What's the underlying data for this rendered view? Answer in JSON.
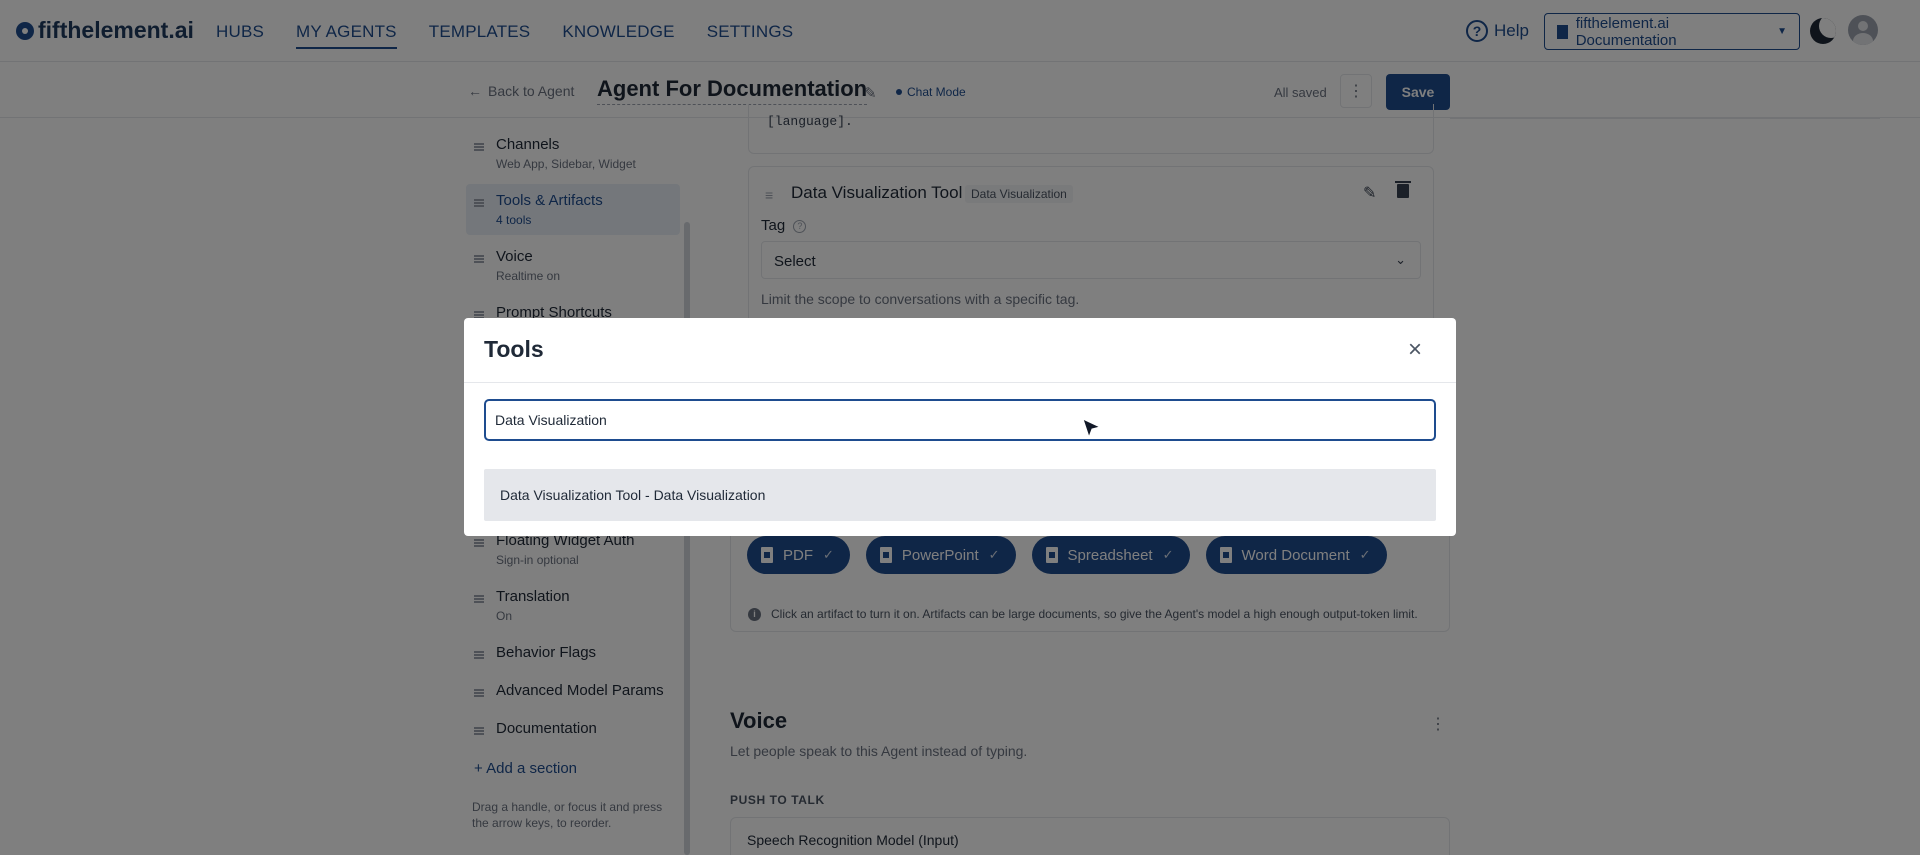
{
  "app": {
    "logo_text": "fifthelement.ai",
    "nav": [
      "HUBS",
      "MY AGENTS",
      "TEMPLATES",
      "KNOWLEDGE",
      "SETTINGS"
    ],
    "help_label": "Help",
    "org_selector": "fifthelement.ai Documentation"
  },
  "header": {
    "back_label": "Back to Agent",
    "agent_title": "Agent For Documentation",
    "mode_label": "Chat Mode",
    "saved_status": "All saved",
    "save_label": "Save"
  },
  "sidebar": {
    "items": [
      {
        "label": "Channels",
        "sub": "Web App, Sidebar, Widget"
      },
      {
        "label": "Tools & Artifacts",
        "sub": "4 tools"
      },
      {
        "label": "Voice",
        "sub": "Realtime on"
      },
      {
        "label": "Prompt Shortcuts",
        "sub": ""
      },
      {
        "label": "Floating Widget Auth",
        "sub": "Sign-in optional"
      },
      {
        "label": "Translation",
        "sub": "On"
      },
      {
        "label": "Behavior Flags",
        "sub": ""
      },
      {
        "label": "Advanced Model Params",
        "sub": ""
      },
      {
        "label": "Documentation",
        "sub": ""
      }
    ],
    "add_section": "Add a section",
    "drag_help": "Drag a handle, or focus it and press the arrow keys, to reorder."
  },
  "main": {
    "code_snippet": "[language].",
    "tool_card": {
      "title": "Data Visualization Tool",
      "badge": "Data Visualization",
      "tag_label": "Tag",
      "tag_select": "Select",
      "tag_help": "Limit the scope to conversations with a specific tag."
    },
    "artifacts": [
      "PDF",
      "PowerPoint",
      "Spreadsheet",
      "Word Document"
    ],
    "artifact_check": "✓",
    "artifacts_note": "Click an artifact to turn it on. Artifacts can be large documents, so give the Agent's model a high enough output-token limit.",
    "voice": {
      "title": "Voice",
      "description": "Let people speak to this Agent instead of typing.",
      "push_to_talk": "PUSH TO TALK",
      "speech_model": "Speech Recognition Model (Input)"
    }
  },
  "modal": {
    "title": "Tools",
    "search_value": "Data Visualization",
    "result": "Data Visualization Tool - Data Visualization"
  },
  "colors": {
    "brand": "#1e4c8f",
    "overlay": "rgba(0,0,0,0.5)"
  }
}
